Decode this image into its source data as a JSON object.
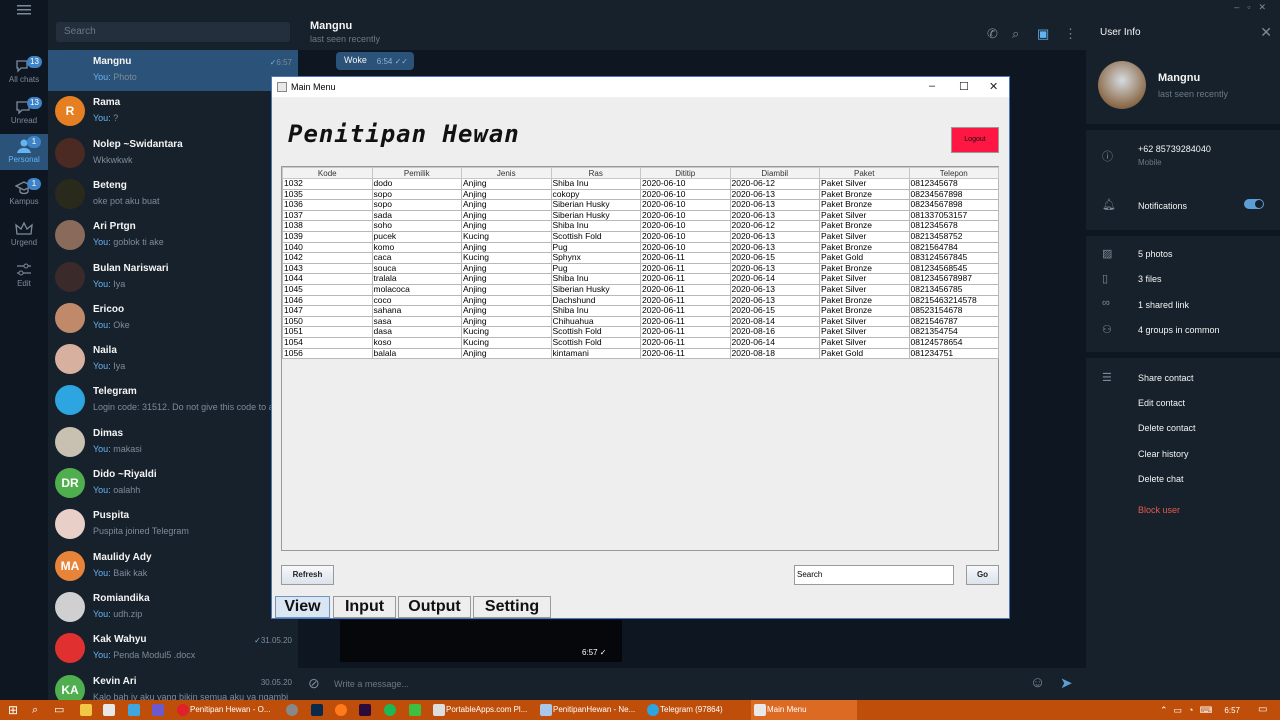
{
  "rail": {
    "items": [
      {
        "label": "All chats",
        "badge": "13"
      },
      {
        "label": "Unread",
        "badge": "13"
      },
      {
        "label": "Personal",
        "badge": "1"
      },
      {
        "label": "Kampus",
        "badge": "1"
      },
      {
        "label": "Urgend",
        "badge": ""
      },
      {
        "label": "Edit",
        "badge": ""
      }
    ]
  },
  "chatlist": {
    "search_placeholder": "Search",
    "chats": [
      {
        "name": "Mangnu",
        "prefix": "You:",
        "preview": "Photo",
        "time": "6:57",
        "check": "✓",
        "color": "#2b5278",
        "initials": ""
      },
      {
        "name": "Rama",
        "prefix": "You:",
        "preview": "?",
        "time": "",
        "check": "✓",
        "color": "#e67e22",
        "initials": "R"
      },
      {
        "name": "Nolep ~Swidantara",
        "prefix": "",
        "preview": "Wkkwkwk",
        "time": "",
        "check": "",
        "color": "#4a2a22",
        "initials": ""
      },
      {
        "name": "Beteng",
        "prefix": "",
        "preview": "oke pot aku buat",
        "time": "",
        "check": "",
        "color": "#2a2a1c",
        "initials": ""
      },
      {
        "name": "Ari Prtgn",
        "prefix": "You:",
        "preview": "goblok ti ake",
        "time": "",
        "check": "✓",
        "color": "#8a6a5a",
        "initials": ""
      },
      {
        "name": "Bulan Nariswari",
        "prefix": "You:",
        "preview": "Iya",
        "time": "",
        "check": "✓",
        "color": "#3a2a2a",
        "initials": ""
      },
      {
        "name": "Ericoo",
        "prefix": "You:",
        "preview": "Oke",
        "time": "",
        "check": "✓",
        "color": "#c08a6a",
        "initials": ""
      },
      {
        "name": "Naila",
        "prefix": "You:",
        "preview": "Iya",
        "time": "",
        "check": "✓",
        "color": "#d8b0a0",
        "initials": ""
      },
      {
        "name": "Telegram",
        "prefix": "",
        "preview": "Login code: 31512. Do not give this code to an",
        "time": "7.",
        "check": "",
        "color": "#2ca5e0",
        "initials": ""
      },
      {
        "name": "Dimas",
        "prefix": "You:",
        "preview": "makasi",
        "time": "3.",
        "check": "✓",
        "color": "#c8c0b0",
        "initials": ""
      },
      {
        "name": "Dido ~Riyaldi",
        "prefix": "You:",
        "preview": "oalahh",
        "time": "3.",
        "check": "",
        "color": "#4fae4e",
        "initials": "DR"
      },
      {
        "name": "Puspita",
        "prefix": "",
        "preview": "Puspita joined Telegram",
        "time": "2.",
        "check": "",
        "color": "#e8d0c8",
        "initials": ""
      },
      {
        "name": "Maulidy Ady",
        "prefix": "You:",
        "preview": "Baik kak",
        "time": "1.",
        "check": "",
        "color": "#e8833a",
        "initials": "MA"
      },
      {
        "name": "Romiandika",
        "prefix": "You:",
        "preview": "udh.zip",
        "time": "1.",
        "check": "✓",
        "color": "#d0d0d0",
        "initials": ""
      },
      {
        "name": "Kak Wahyu",
        "prefix": "You:",
        "preview": "Penda Modul5 .docx",
        "time": "31.05.20",
        "check": "✓",
        "color": "#e03030",
        "initials": ""
      },
      {
        "name": "Kevin Ari",
        "prefix": "",
        "preview": "Kalo bah iy aku yang bikin semua aku ya ngambi",
        "time": "30.05.20",
        "check": "",
        "color": "#4fae4e",
        "initials": "KA"
      }
    ]
  },
  "chat": {
    "name": "Mangnu",
    "status": "last seen recently",
    "bubble_text": "Woke",
    "bubble_time": "6:54",
    "media_time": "6:57",
    "composer_placeholder": "Write a message..."
  },
  "userinfo": {
    "title": "User Info",
    "name": "Mangnu",
    "status": "last seen recently",
    "phone": "+62 85739284040",
    "phone_label": "Mobile",
    "notifications": "Notifications",
    "media": [
      "5 photos",
      "3 files",
      "1 shared link",
      "4 groups in common"
    ],
    "actions": [
      "Share contact",
      "Edit contact",
      "Delete contact",
      "Clear history",
      "Delete chat"
    ],
    "block": "Block user"
  },
  "java": {
    "window_title": "Main Menu",
    "app_title": "Penitipan Hewan",
    "logout": "Logout",
    "columns": [
      "Kode",
      "Pemilik",
      "Jenis",
      "Ras",
      "Dititip",
      "Diambil",
      "Paket",
      "Telepon"
    ],
    "rows": [
      [
        "1032",
        "dodo",
        "Anjing",
        "Shiba Inu",
        "2020-06-10",
        "2020-06-12",
        "Paket Silver",
        "0812345678"
      ],
      [
        "1035",
        "sopo",
        "Anjing",
        "cokopy",
        "2020-06-10",
        "2020-06-13",
        "Paket Bronze",
        "08234567898"
      ],
      [
        "1036",
        "sopo",
        "Anjing",
        "Siberian Husky",
        "2020-06-10",
        "2020-06-13",
        "Paket Bronze",
        "08234567898"
      ],
      [
        "1037",
        "sada",
        "Anjing",
        "Siberian Husky",
        "2020-06-10",
        "2020-06-13",
        "Paket Silver",
        "081337053157"
      ],
      [
        "1038",
        "soho",
        "Anjing",
        "Shiba Inu",
        "2020-06-10",
        "2020-06-12",
        "Paket Bronze",
        "0812345678"
      ],
      [
        "1039",
        "pucek",
        "Kucing",
        "Scottish Fold",
        "2020-06-10",
        "2020-06-13",
        "Paket Silver",
        "08213458752"
      ],
      [
        "1040",
        "komo",
        "Anjing",
        "Pug",
        "2020-06-10",
        "2020-06-13",
        "Paket Bronze",
        "0821564784"
      ],
      [
        "1042",
        "caca",
        "Kucing",
        "Sphynx",
        "2020-06-11",
        "2020-06-15",
        "Paket Gold",
        "083124567845"
      ],
      [
        "1043",
        "souca",
        "Anjing",
        "Pug",
        "2020-06-11",
        "2020-06-13",
        "Paket Bronze",
        "081234568545"
      ],
      [
        "1044",
        "tralala",
        "Anjing",
        "Shiba Inu",
        "2020-06-11",
        "2020-06-14",
        "Paket Silver",
        "0812345678987"
      ],
      [
        "1045",
        "molacoca",
        "Anjing",
        "Siberian Husky",
        "2020-06-11",
        "2020-06-13",
        "Paket Silver",
        "08213456785"
      ],
      [
        "1046",
        "coco",
        "Anjing",
        "Dachshund",
        "2020-06-11",
        "2020-06-13",
        "Paket Bronze",
        "08215463214578"
      ],
      [
        "1047",
        "sahana",
        "Anjing",
        "Shiba Inu",
        "2020-06-11",
        "2020-06-15",
        "Paket Bronze",
        "08523154678"
      ],
      [
        "1050",
        "sasa",
        "Anjing",
        "Chihuahua",
        "2020-06-11",
        "2020-08-14",
        "Paket Silver",
        "0821546787"
      ],
      [
        "1051",
        "dasa",
        "Kucing",
        "Scottish Fold",
        "2020-06-11",
        "2020-08-16",
        "Paket Silver",
        "0821354754"
      ],
      [
        "1054",
        "koso",
        "Kucing",
        "Scottish Fold",
        "2020-06-11",
        "2020-06-14",
        "Paket Silver",
        "08124578654"
      ],
      [
        "1056",
        "balala",
        "Anjing",
        "kintamani",
        "2020-06-11",
        "2020-08-18",
        "Paket Gold",
        "081234751"
      ]
    ],
    "refresh": "Refresh",
    "search_value": "Search",
    "go": "Go",
    "tabs": [
      "View",
      "Input",
      "Output",
      "Setting"
    ]
  },
  "taskbar": {
    "items": [
      "Penitipan Hewan - O...",
      "PortableApps.com Pl...",
      "PenitipanHewan - Ne...",
      "Telegram (97864)",
      "Main Menu"
    ],
    "clock": "6:57"
  },
  "colors": {
    "accent": "#2b5278",
    "logout": "#ff1744",
    "taskbar": "#bf4e0a"
  }
}
